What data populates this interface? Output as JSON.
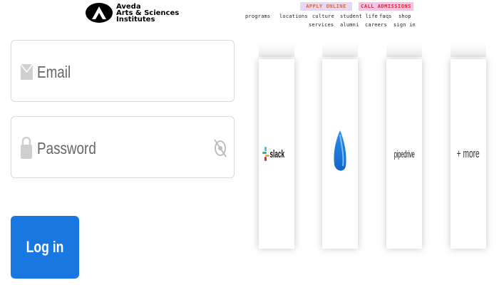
{
  "header": {
    "logo_lines": [
      "Aveda",
      "Arts & Sciences",
      "Institutes"
    ],
    "apply_label": "APPLY ONLINE",
    "call_label": "CALL ADMISSIONS",
    "nav_row1": [
      "programs",
      "locations",
      "culture",
      "student life",
      "faqs",
      "shop"
    ],
    "nav_row2": [
      "services",
      "alumni",
      "careers",
      "sign in"
    ]
  },
  "form": {
    "email_placeholder": "Email",
    "password_placeholder": "Password",
    "login_label": "Log in"
  },
  "integrations": {
    "items": [
      "slack",
      "fluent-app",
      "pipedrive",
      "+ more"
    ],
    "slack_label": "slack",
    "pipedrive_label": "pipedrive",
    "more_label": "+ more"
  },
  "colors": {
    "login_button": "#1877e0",
    "apply_bg": "#e3d9f6",
    "call_bg": "#f3c3e3"
  },
  "icons": [
    "envelope-icon",
    "lock-icon",
    "eye-off-icon",
    "slack-logo-icon",
    "fluent-logo-icon",
    "aveda-logo-icon"
  ]
}
